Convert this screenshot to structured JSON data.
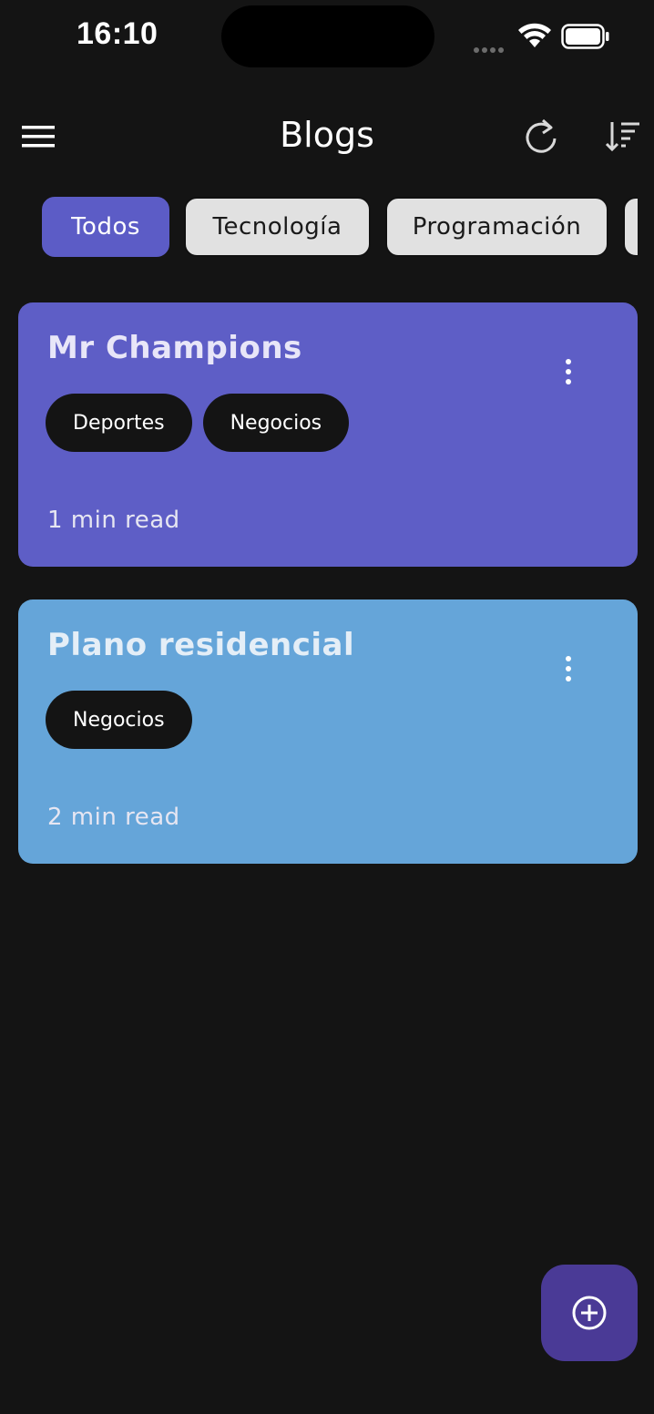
{
  "status_bar": {
    "time": "16:10",
    "wifi_icon": "wifi-icon",
    "battery_icon": "battery-icon"
  },
  "app_bar": {
    "title": "Blogs",
    "menu_icon": "hamburger-menu-icon",
    "refresh_icon": "refresh-icon",
    "sort_icon": "sort-icon"
  },
  "filters": {
    "chips": [
      {
        "label": "Todos",
        "selected": true
      },
      {
        "label": "Tecnología",
        "selected": false
      },
      {
        "label": "Programación",
        "selected": false
      }
    ]
  },
  "blogs": [
    {
      "title": "Mr Champions",
      "tags": [
        "Deportes",
        "Negocios"
      ],
      "read_time": "1 min read",
      "color": "#5e5ec6"
    },
    {
      "title": "Plano residencial",
      "tags": [
        "Negocios"
      ],
      "read_time": "2 min read",
      "color": "#65a5d9"
    }
  ],
  "fab": {
    "icon": "add-circle-icon"
  },
  "colors": {
    "background": "#141414",
    "accent": "#5c5cc6",
    "fab": "#4a3a96"
  }
}
